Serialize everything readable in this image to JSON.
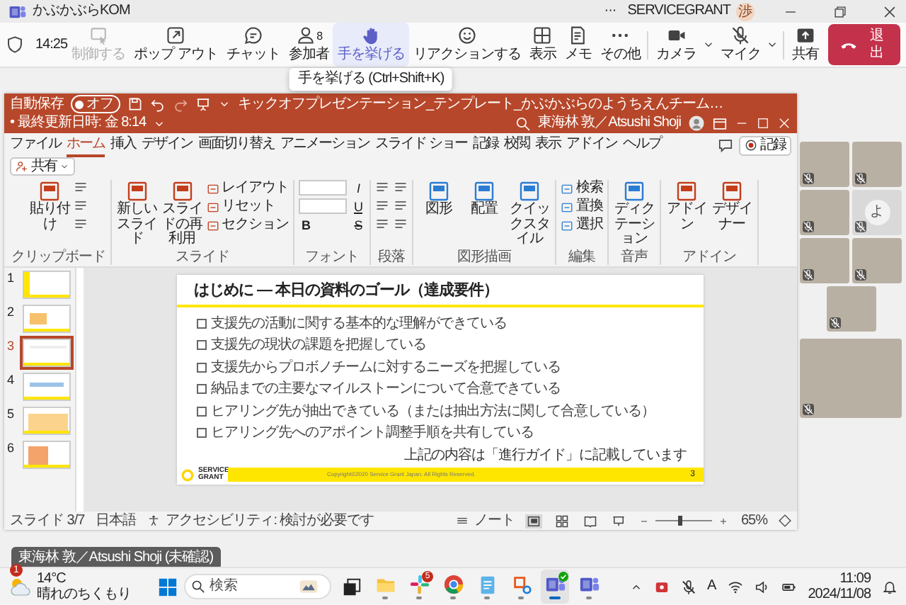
{
  "teams": {
    "title": "かぶかぶらKOM",
    "more": "···",
    "org": "SERVICEGRANT",
    "avatar": "渉",
    "time": "14:25",
    "toolbar": [
      {
        "kind": "button",
        "label": "制御する",
        "disabled": true,
        "selected": false
      },
      {
        "kind": "button",
        "label": "ポップ アウト",
        "disabled": false,
        "selected": false
      },
      {
        "kind": "button",
        "label": "チャット",
        "disabled": false,
        "selected": false
      },
      {
        "kind": "button",
        "label": "参加者",
        "count": "8",
        "disabled": false,
        "selected": false
      },
      {
        "kind": "button",
        "label": "手を挙げる",
        "disabled": false,
        "selected": true,
        "tooltip": "手を挙げる (Ctrl+Shift+K)"
      },
      {
        "kind": "button",
        "label": "リアクションする",
        "disabled": false,
        "selected": false
      },
      {
        "kind": "button",
        "label": "表示",
        "disabled": false,
        "selected": false
      },
      {
        "kind": "button",
        "label": "メモ",
        "disabled": false,
        "selected": false
      },
      {
        "kind": "button",
        "label": "その他",
        "disabled": false,
        "selected": false
      },
      {
        "kind": "device",
        "label": "カメラ",
        "off": false,
        "disabled": false,
        "selected": false
      },
      {
        "kind": "device",
        "label": "マイク",
        "off": true,
        "disabled": false,
        "selected": false
      },
      {
        "kind": "button",
        "label": "共有",
        "disabled": false,
        "selected": false
      }
    ],
    "leave": "退出"
  },
  "ppt": {
    "autosave": "自動保存",
    "autosave_toggle": "オフ",
    "autosave_on": false,
    "file_title": "キックオフプレゼンテーション_テンプレート_かぶかぶらのようちえんチーム…",
    "modified": "• 最終更新日時: 金 8:14",
    "user": "東海林 敦／Atsushi Shoji",
    "tabs": [
      {
        "label": "ファイル",
        "selected": false
      },
      {
        "label": "ホーム",
        "selected": true
      },
      {
        "label": "挿入",
        "selected": false
      },
      {
        "label": "デザイン",
        "selected": false
      },
      {
        "label": "画面切り替え",
        "selected": false
      },
      {
        "label": "アニメーション",
        "selected": false
      },
      {
        "label": "スライド ショー",
        "selected": false
      },
      {
        "label": "記録",
        "selected": false
      },
      {
        "label": "校閲",
        "selected": false
      },
      {
        "label": "表示",
        "selected": false
      },
      {
        "label": "アドイン",
        "selected": false
      },
      {
        "label": "ヘルプ",
        "selected": false
      }
    ],
    "record_button": "記録",
    "share_button": "共有",
    "ribbon": [
      {
        "label": "クリップボード",
        "items": [
          {
            "kind": "large",
            "label": "貼り付け"
          },
          {
            "kind": "icon"
          },
          {
            "kind": "icon"
          },
          {
            "kind": "icon"
          }
        ]
      },
      {
        "label": "スライド",
        "items": [
          {
            "kind": "large",
            "label": "新しいスライド"
          },
          {
            "kind": "large",
            "label": "スライドの再利用"
          },
          {
            "kind": "small",
            "label": "レイアウト"
          },
          {
            "kind": "small",
            "label": "リセット"
          },
          {
            "kind": "small",
            "label": "セクション"
          }
        ]
      },
      {
        "label": "フォント",
        "items": [
          {
            "kind": "field"
          },
          {
            "kind": "field"
          },
          {
            "kind": "glyph",
            "label": "B"
          },
          {
            "kind": "glyph",
            "label": "I"
          },
          {
            "kind": "glyph",
            "label": "U"
          },
          {
            "kind": "glyph",
            "label": "S"
          }
        ]
      },
      {
        "label": "段落",
        "items": [
          {
            "kind": "icon"
          },
          {
            "kind": "icon"
          },
          {
            "kind": "icon"
          },
          {
            "kind": "icon"
          },
          {
            "kind": "icon"
          },
          {
            "kind": "icon"
          }
        ]
      },
      {
        "label": "図形描画",
        "items": [
          {
            "kind": "large",
            "label": "図形"
          },
          {
            "kind": "large",
            "label": "配置"
          },
          {
            "kind": "large",
            "label": "クイックスタイル"
          }
        ]
      },
      {
        "label": "編集",
        "items": [
          {
            "kind": "small",
            "label": "検索"
          },
          {
            "kind": "small",
            "label": "置換"
          },
          {
            "kind": "small",
            "label": "選択"
          }
        ]
      },
      {
        "label": "音声",
        "items": [
          {
            "kind": "large",
            "label": "ディクテーション"
          }
        ]
      },
      {
        "label": "アドイン",
        "items": [
          {
            "kind": "large",
            "label": "アドイン"
          },
          {
            "kind": "large",
            "label": "デザイナー"
          }
        ]
      }
    ],
    "thumbnails": [
      {
        "number": "1",
        "selected": false
      },
      {
        "number": "2",
        "selected": false
      },
      {
        "number": "3",
        "selected": true
      },
      {
        "number": "4",
        "selected": false
      },
      {
        "number": "5",
        "selected": false
      },
      {
        "number": "6",
        "selected": false
      }
    ],
    "slide": {
      "title": "はじめに ― 本日の資料のゴール（達成要件）",
      "items": [
        {
          "text": "支援先の活動に関する基本的な理解ができている",
          "checked": false
        },
        {
          "text": "支援先の現状の課題を把握している",
          "checked": false
        },
        {
          "text": "支援先からプロボノチームに対するニーズを把握している",
          "checked": false
        },
        {
          "text": "納品までの主要なマイルストーンについて合意できている",
          "checked": false
        },
        {
          "text": "ヒアリング先が抽出できている（または抽出方法に関して合意している）",
          "checked": false
        },
        {
          "text": "ヒアリング先へのアポイント調整手順を共有している",
          "checked": false
        }
      ],
      "note": "上記の内容は「進行ガイド」に記載しています",
      "logo": "SERVICE GRANT",
      "copyright": "Copyright©2020 Service Grant Japan. All Rights Reserved.",
      "page": "3"
    },
    "status": {
      "slide": "スライド 3/7",
      "language": "日本語",
      "accessibility": "アクセシビリティ: 検討が必要です",
      "notes": "ノート",
      "views": [
        {
          "selected": true
        },
        {
          "selected": false
        },
        {
          "selected": false
        },
        {
          "selected": false
        }
      ],
      "zoom": {
        "level": 0.42
      },
      "zoom_text": "65%"
    }
  },
  "participant_rows": [
    [
      {
        "kind": "video",
        "muted": true
      },
      {
        "kind": "video",
        "muted": true
      }
    ],
    [
      {
        "kind": "video",
        "muted": true
      },
      {
        "kind": "avatar",
        "initial": "よ",
        "muted": true
      }
    ],
    [
      {
        "kind": "video",
        "muted": true
      },
      {
        "kind": "video",
        "muted": true
      }
    ],
    [
      {
        "kind": "video",
        "muted": true
      }
    ],
    [
      {
        "kind": "video",
        "muted": true
      }
    ]
  ],
  "name_label": "東海林 敦／Atsushi Shoji (未確認)",
  "taskbar": {
    "weather_badge": "1",
    "temperature": "14°C",
    "condition": "晴れのちくもり",
    "search_placeholder": "検索",
    "apps": [
      {
        "running": false,
        "active": false
      },
      {
        "running": true,
        "active": false
      },
      {
        "running": true,
        "active": false,
        "badge": "5"
      },
      {
        "running": true,
        "active": false
      },
      {
        "running": true,
        "active": false
      },
      {
        "running": true,
        "active": false
      },
      {
        "running": true,
        "active": true,
        "verified": true
      },
      {
        "running": true,
        "active": false
      }
    ],
    "ime": "A",
    "time": "11:09",
    "date": "2024/11/08"
  }
}
